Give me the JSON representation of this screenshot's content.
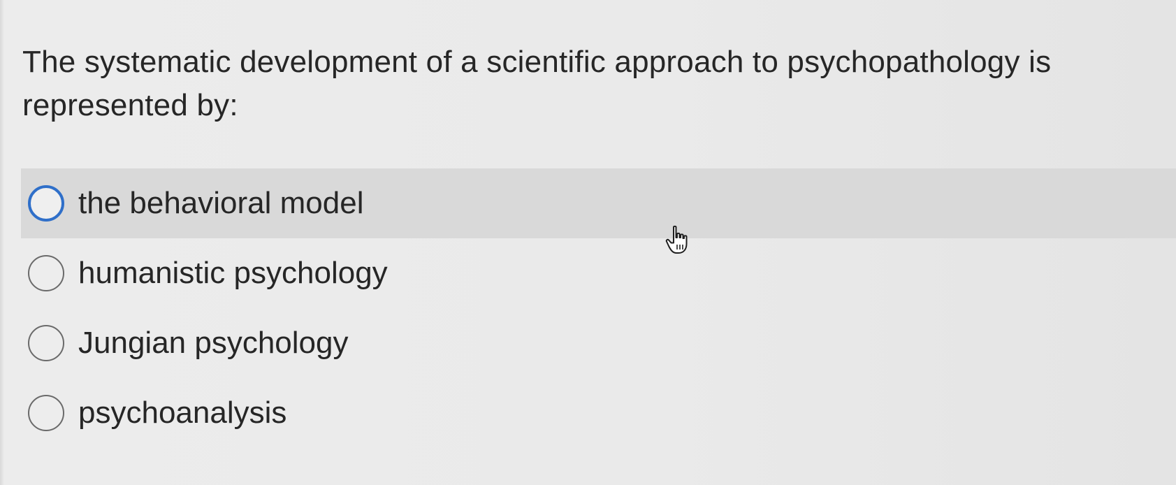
{
  "question": {
    "text": "The systematic development of a scientific approach to psychopathology is represented by:"
  },
  "options": [
    {
      "label": "the behavioral model",
      "hovered": true
    },
    {
      "label": "humanistic psychology",
      "hovered": false
    },
    {
      "label": "Jungian psychology",
      "hovered": false
    },
    {
      "label": "psychoanalysis",
      "hovered": false
    }
  ],
  "colors": {
    "background": "#ebebeb",
    "hover_row": "#d9d9d9",
    "radio_focus": "#2f6fc9",
    "radio_border": "#6a6a6a",
    "text": "#262626"
  },
  "icons": {
    "cursor": "hand-pointer-icon",
    "radio": "radio-button-icon"
  }
}
